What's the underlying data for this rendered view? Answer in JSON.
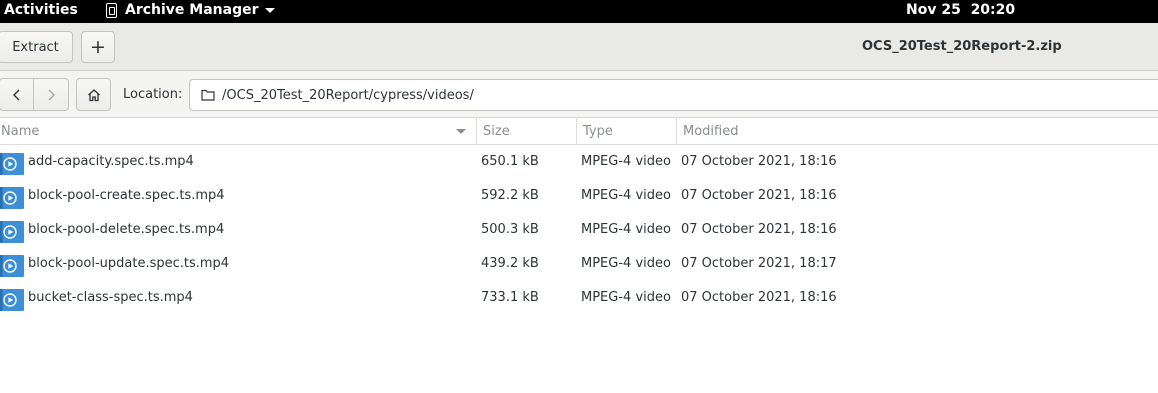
{
  "topbar": {
    "activities": "Activities",
    "app_name": "Archive Manager",
    "clock": "Nov 25  20:20"
  },
  "header": {
    "extract_label": "Extract",
    "add_label": "+",
    "window_title": "OCS_20Test_20Report-2.zip"
  },
  "location": {
    "label": "Location:",
    "path": "/OCS_20Test_20Report/cypress/videos/"
  },
  "columns": {
    "name": "Name",
    "size": "Size",
    "type": "Type",
    "modified": "Modified"
  },
  "files": [
    {
      "name": "add-capacity.spec.ts.mp4",
      "size": "650.1 kB",
      "type": "MPEG-4 video",
      "modified": "07 October 2021, 18:16"
    },
    {
      "name": "block-pool-create.spec.ts.mp4",
      "size": "592.2 kB",
      "type": "MPEG-4 video",
      "modified": "07 October 2021, 18:16"
    },
    {
      "name": "block-pool-delete.spec.ts.mp4",
      "size": "500.3 kB",
      "type": "MPEG-4 video",
      "modified": "07 October 2021, 18:16"
    },
    {
      "name": "block-pool-update.spec.ts.mp4",
      "size": "439.2 kB",
      "type": "MPEG-4 video",
      "modified": "07 October 2021, 18:17"
    },
    {
      "name": "bucket-class-spec.ts.mp4",
      "size": "733.1 kB",
      "type": "MPEG-4 video",
      "modified": "07 October 2021, 18:16"
    }
  ],
  "icons": {
    "file_icon": "video-file-icon",
    "accent_color": "#3d8fd6"
  }
}
